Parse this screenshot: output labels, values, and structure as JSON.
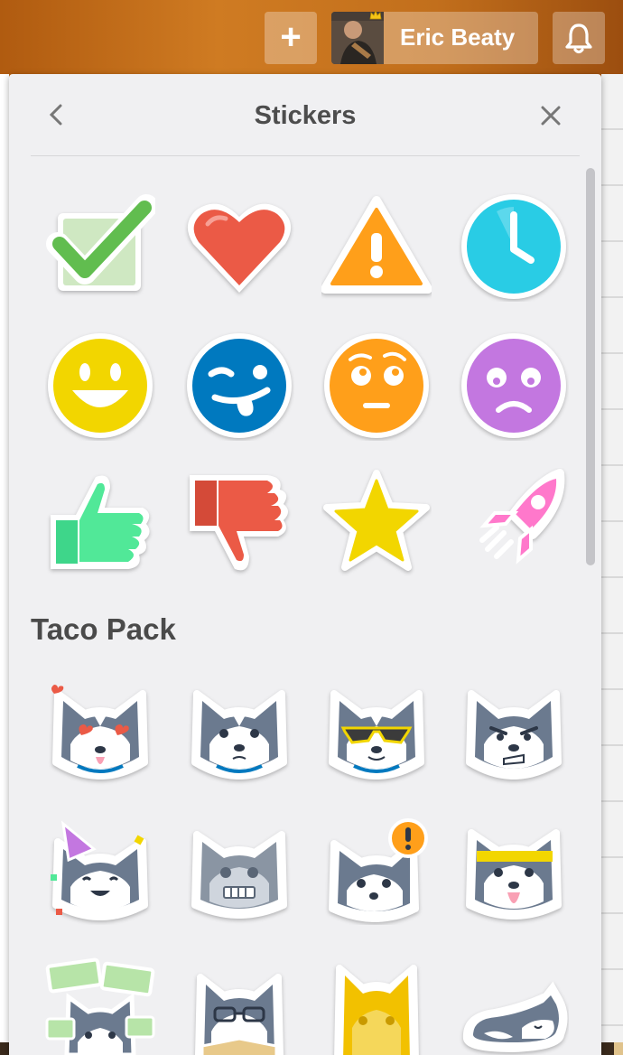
{
  "header": {
    "add_label": "+",
    "user_name": "Eric Beaty"
  },
  "panel": {
    "title": "Stickers",
    "section_title": "Taco Pack"
  },
  "stickers": {
    "standard": [
      "check",
      "heart",
      "warning",
      "clock",
      "smile",
      "silly",
      "wondering",
      "worried",
      "thumbs-up",
      "thumbs-down",
      "star",
      "rocketship"
    ],
    "taco_pack": [
      "taco-love",
      "taco-confused",
      "taco-cool",
      "taco-angry",
      "taco-celebrate",
      "taco-robot",
      "taco-alert",
      "taco-active",
      "taco-money",
      "taco-reading",
      "taco-trophy",
      "taco-sleeping"
    ]
  },
  "colors": {
    "panel_bg": "#f0f0f2",
    "check_green": "#61bd4f",
    "heart_red": "#eb5a46",
    "warning_orange": "#ff9f1a",
    "clock_blue": "#29cce5",
    "smile_yellow": "#f2d600",
    "silly_blue": "#0079bf",
    "worried_purple": "#c377e0",
    "thumbs_up_green": "#51e898",
    "rocket_pink": "#ff78cb"
  }
}
